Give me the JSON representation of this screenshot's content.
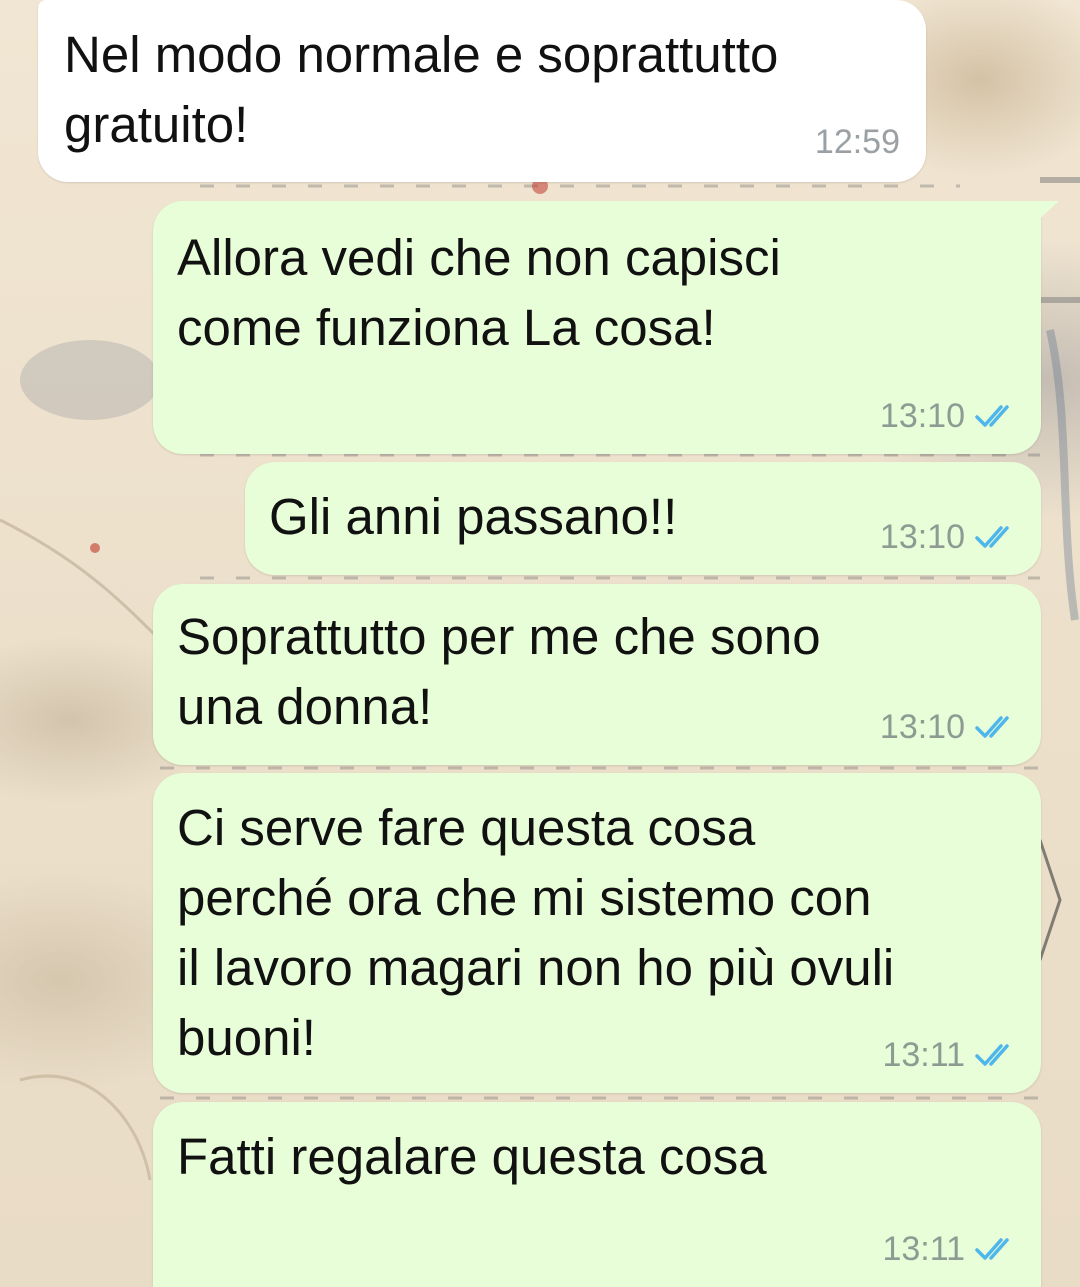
{
  "chat": {
    "messages": [
      {
        "direction": "incoming",
        "text": "Nel modo normale e soprattutto\ngratuito!",
        "time": "12:59",
        "status": ""
      },
      {
        "direction": "outgoing",
        "text": "Allora vedi che non capisci\ncome funziona La cosa!",
        "time": "13:10",
        "status": "read"
      },
      {
        "direction": "outgoing",
        "text": "Gli anni passano!!",
        "time": "13:10",
        "status": "read"
      },
      {
        "direction": "outgoing",
        "text": "Soprattutto per me che sono\nuna donna!",
        "time": "13:10",
        "status": "read"
      },
      {
        "direction": "outgoing",
        "text": "Ci serve fare questa cosa\nperché ora che mi sistemo con\nil lavoro magari non ho più ovuli\nbuoni!",
        "time": "13:11",
        "status": "read"
      },
      {
        "direction": "outgoing",
        "text": "Fatti regalare questa cosa",
        "time": "13:11",
        "status": "read"
      }
    ]
  },
  "colors": {
    "incoming_bubble": "#ffffff",
    "outgoing_bubble": "#e7fed8",
    "read_ticks": "#4fb6ec",
    "wallpaper": "#efe3cf"
  },
  "icons": {
    "read_status": "double-check-icon"
  }
}
